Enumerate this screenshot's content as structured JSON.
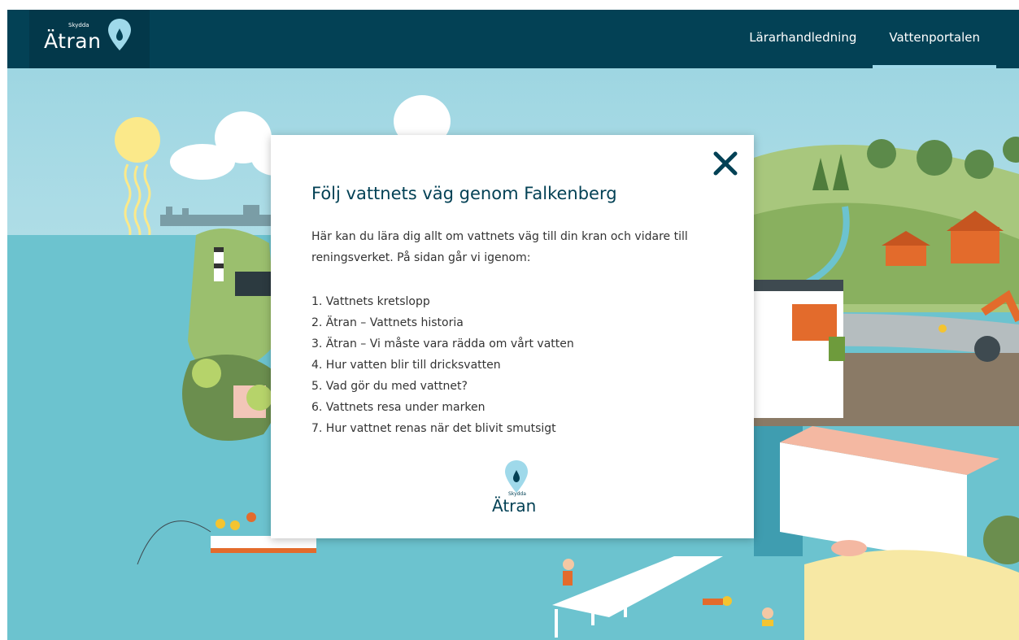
{
  "header": {
    "logo_word": "Ätran",
    "logo_sub": "Skydda",
    "nav": [
      {
        "label": "Lärarhandledning",
        "active": false
      },
      {
        "label": "Vattenportalen",
        "active": true
      }
    ]
  },
  "modal": {
    "title": "Följ vattnets väg genom Falkenberg",
    "intro": "Här kan du lära dig allt om vattnets väg till din kran och vidare till reningsverket. På sidan går vi igenom:",
    "items": [
      "1. Vattnets kretslopp",
      "2. Ätran – Vattnets historia",
      "3. Ätran – Vi måste vara rädda om vårt vatten",
      "4. Hur vatten blir till dricksvatten",
      "5. Vad gör du med vattnet?",
      "6. Vattnets resa under marken",
      "7. Hur vattnet renas när det blivit smutsigt"
    ],
    "logo_word": "Ätran",
    "logo_sub": "Skydda",
    "close_icon": "close-icon"
  },
  "colors": {
    "header": "#034155",
    "sea": "#6cc3cf",
    "sky": "#a9dde6",
    "accent": "#9fd9ea"
  }
}
